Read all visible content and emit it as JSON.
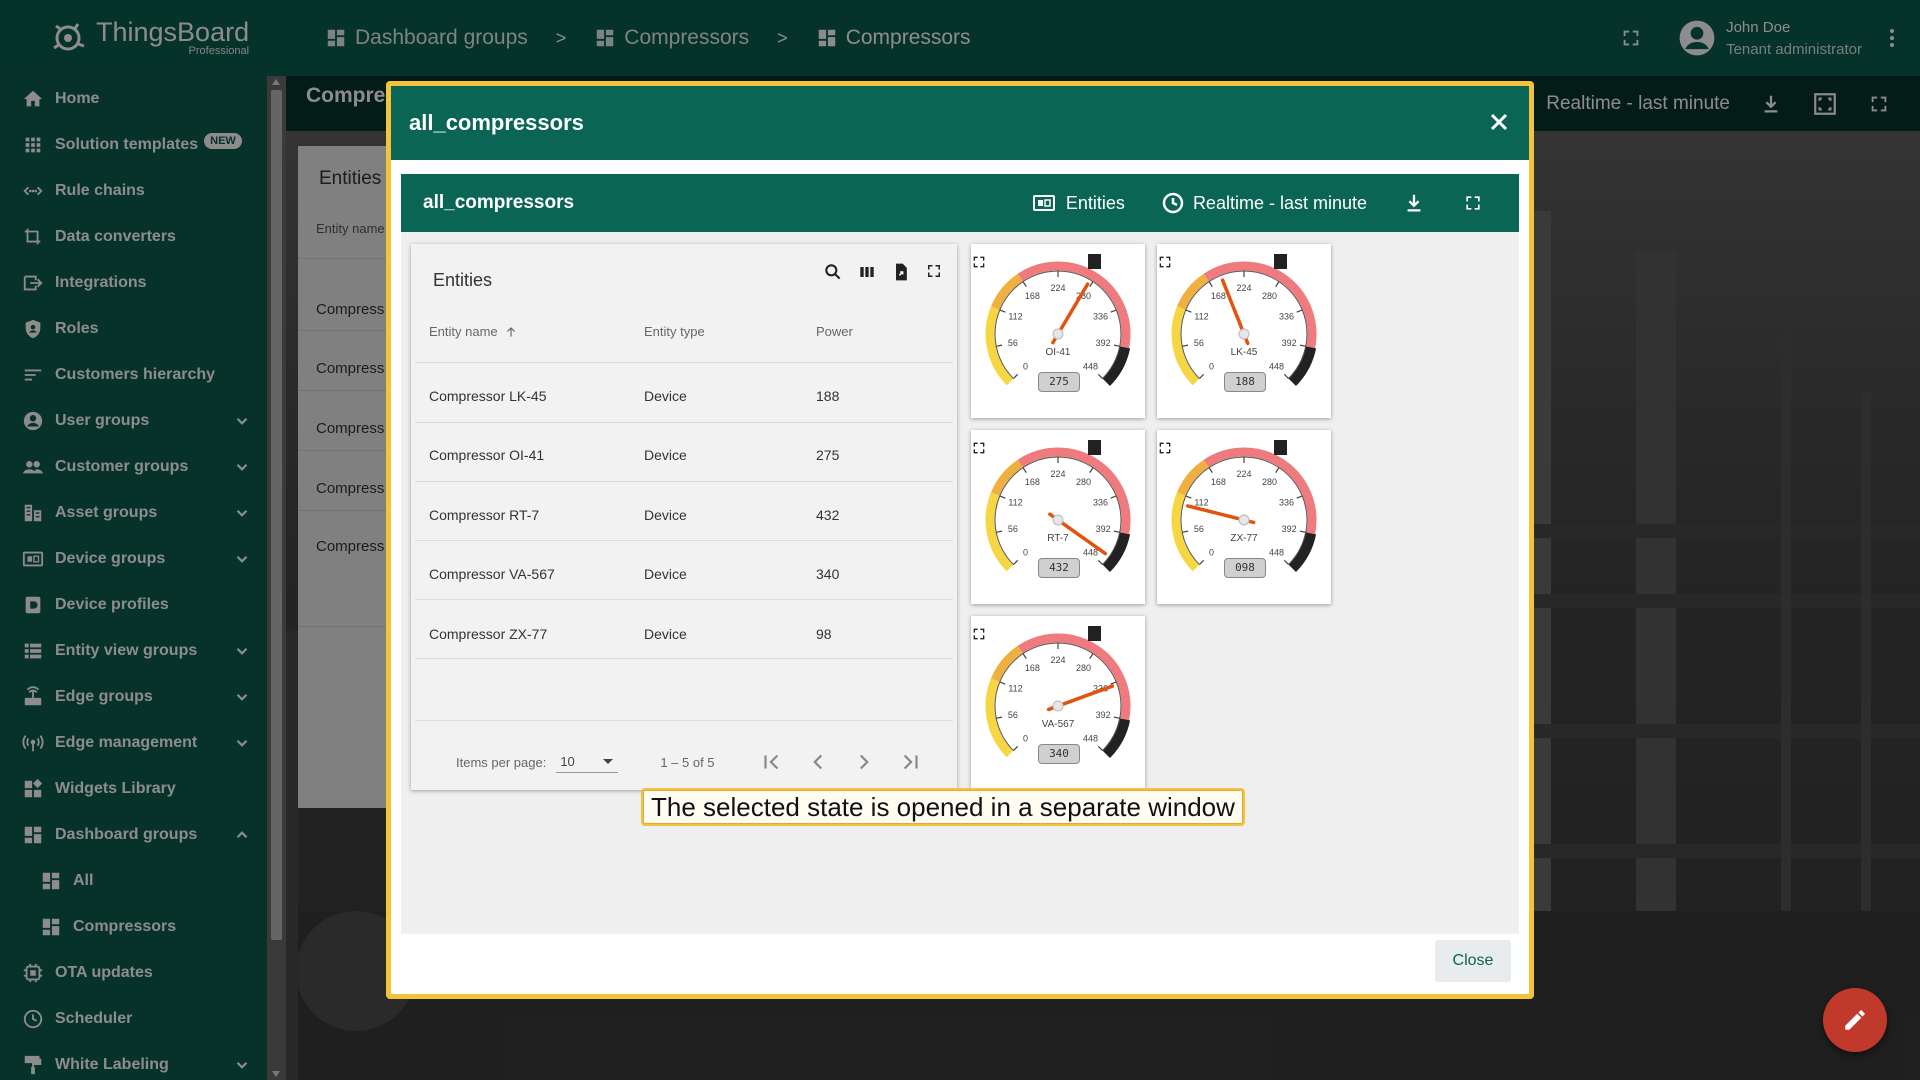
{
  "topbar": {
    "brand": "ThingsBoard",
    "edition": "Professional",
    "breadcrumbs": [
      "Dashboard groups",
      "Compressors",
      "Compressors"
    ],
    "separator": ">",
    "user_name": "John Doe",
    "user_role": "Tenant administrator"
  },
  "sidebar": {
    "items": [
      {
        "label": "Home",
        "icon": "home-icon"
      },
      {
        "label": "Solution templates",
        "icon": "grid-icon",
        "badge": "NEW"
      },
      {
        "label": "Rule chains",
        "icon": "rule-chain-icon"
      },
      {
        "label": "Data converters",
        "icon": "converter-icon"
      },
      {
        "label": "Integrations",
        "icon": "integration-icon"
      },
      {
        "label": "Roles",
        "icon": "shield-icon"
      },
      {
        "label": "Customers hierarchy",
        "icon": "hierarchy-icon"
      },
      {
        "label": "User groups",
        "icon": "user-icon"
      },
      {
        "label": "Customer groups",
        "icon": "people-icon"
      },
      {
        "label": "Asset groups",
        "icon": "asset-icon"
      },
      {
        "label": "Device groups",
        "icon": "device-icon"
      },
      {
        "label": "Device profiles",
        "icon": "profile-icon"
      },
      {
        "label": "Entity view groups",
        "icon": "entity-view-icon"
      },
      {
        "label": "Edge groups",
        "icon": "edge-icon"
      },
      {
        "label": "Edge management",
        "icon": "edge-management-icon"
      },
      {
        "label": "Widgets Library",
        "icon": "widgets-icon"
      },
      {
        "label": "Dashboard groups",
        "icon": "dashboard-icon"
      },
      {
        "label": "All",
        "icon": "dashboard-icon"
      },
      {
        "label": "Compressors",
        "icon": "dashboard-icon"
      },
      {
        "label": "OTA updates",
        "icon": "ota-icon"
      },
      {
        "label": "Scheduler",
        "icon": "clock-icon"
      },
      {
        "label": "White Labeling",
        "icon": "brush-icon"
      }
    ]
  },
  "background": {
    "title": "Compre",
    "timewindow": "Realtime - last minute",
    "card_title": "Entities",
    "card_header": "Entity name",
    "rows": [
      "Compress",
      "Compress",
      "Compress",
      "Compress",
      "Compress"
    ]
  },
  "dialog": {
    "title": "all_compressors",
    "inner_title": "all_compressors",
    "entities_label": "Entities",
    "timewindow": "Realtime - last minute",
    "table": {
      "title": "Entities",
      "columns": [
        "Entity name",
        "Entity type",
        "Power"
      ],
      "rows": [
        [
          "Compressor LK-45",
          "Device",
          "188"
        ],
        [
          "Compressor OI-41",
          "Device",
          "275"
        ],
        [
          "Compressor RT-7",
          "Device",
          "432"
        ],
        [
          "Compressor VA-567",
          "Device",
          "340"
        ],
        [
          "Compressor ZX-77",
          "Device",
          "98"
        ]
      ],
      "items_per_page_label": "Items per page:",
      "items_per_page": "10",
      "range": "1 – 5 of 5"
    },
    "gauges": [
      {
        "label": "OI-41",
        "value": 275,
        "display": "275"
      },
      {
        "label": "LK-45",
        "value": 188,
        "display": "188"
      },
      {
        "label": "RT-7",
        "value": 432,
        "display": "432"
      },
      {
        "label": "ZX-77",
        "value": 98,
        "display": "098"
      },
      {
        "label": "VA-567",
        "value": 340,
        "display": "340"
      }
    ],
    "gauge_ticks": [
      "0",
      "56",
      "112",
      "168",
      "224",
      "280",
      "336",
      "392",
      "448"
    ],
    "tooltip": "The selected state is opened in a separate window",
    "close_button": "Close"
  },
  "colors": {
    "primary": "#0a6555",
    "sidebar": "#0d5b4b",
    "highlight": "#f5c33b",
    "fab": "#c0392b"
  }
}
